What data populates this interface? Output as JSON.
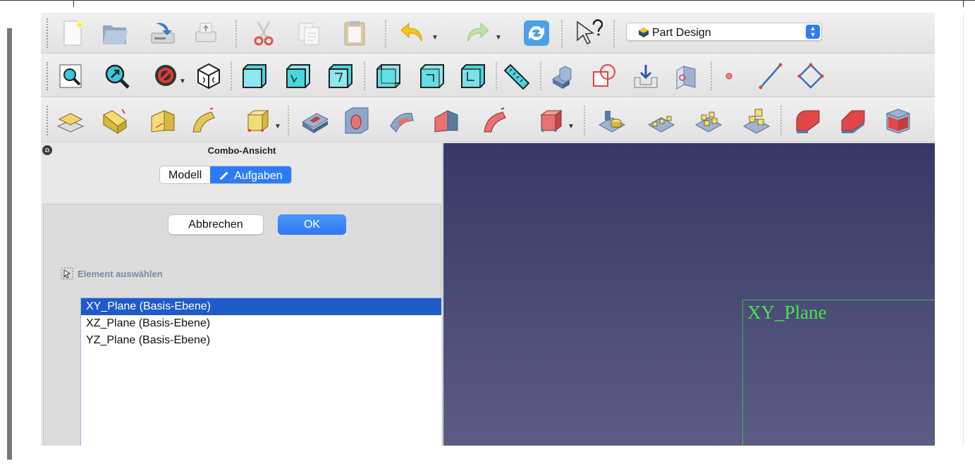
{
  "workbench": {
    "label": "Part Design"
  },
  "combo": {
    "title": "Combo-Ansicht",
    "tabs": [
      {
        "label": "Modell"
      },
      {
        "label": "Aufgaben"
      }
    ],
    "buttons": {
      "cancel": "Abbrechen",
      "ok": "OK"
    },
    "select_label": "Element auswählen",
    "planes": [
      {
        "label": "XY_Plane (Basis-Ebene)",
        "selected": true
      },
      {
        "label": "XZ_Plane (Basis-Ebene)",
        "selected": false
      },
      {
        "label": "YZ_Plane (Basis-Ebene)",
        "selected": false
      }
    ]
  },
  "view3d": {
    "plane_label": "XY_Plane"
  },
  "colors": {
    "accent": "#2d7cf6",
    "selection": "#1f5bc8",
    "viewport_top": "#383866",
    "viewport_bottom": "#5c5c86",
    "plane_green": "#46e646"
  },
  "toolbars": {
    "file": [
      "new-document-icon",
      "open-folder-icon",
      "save-icon",
      "print-icon",
      "cut-icon",
      "copy-icon",
      "paste-icon",
      "undo-icon",
      "redo-icon",
      "refresh-icon",
      "whats-this-icon"
    ],
    "view": [
      "fit-all-icon",
      "fit-selection-icon",
      "draw-style-icon",
      "isometric-view-icon",
      "front-view-icon",
      "top-view-icon",
      "right-view-icon",
      "rear-view-icon",
      "bottom-view-icon",
      "left-view-icon",
      "measure-icon",
      "body-icon",
      "part-icon",
      "link-icon",
      "clone-icon",
      "point-icon",
      "line-icon",
      "plane-icon"
    ],
    "partdesign": [
      "new-sketch-icon",
      "pad-icon",
      "revolution-icon",
      "additive-loft-icon",
      "additive-pipe-icon",
      "additive-primitive-icon",
      "pocket-icon",
      "hole-icon",
      "groove-icon",
      "subtractive-loft-icon",
      "subtractive-pipe-icon",
      "subtractive-primitive-icon",
      "mirrored-icon",
      "linear-pattern-icon",
      "polar-pattern-icon",
      "multi-transform-icon",
      "fillet-icon",
      "chamfer-icon",
      "draft-icon"
    ]
  }
}
